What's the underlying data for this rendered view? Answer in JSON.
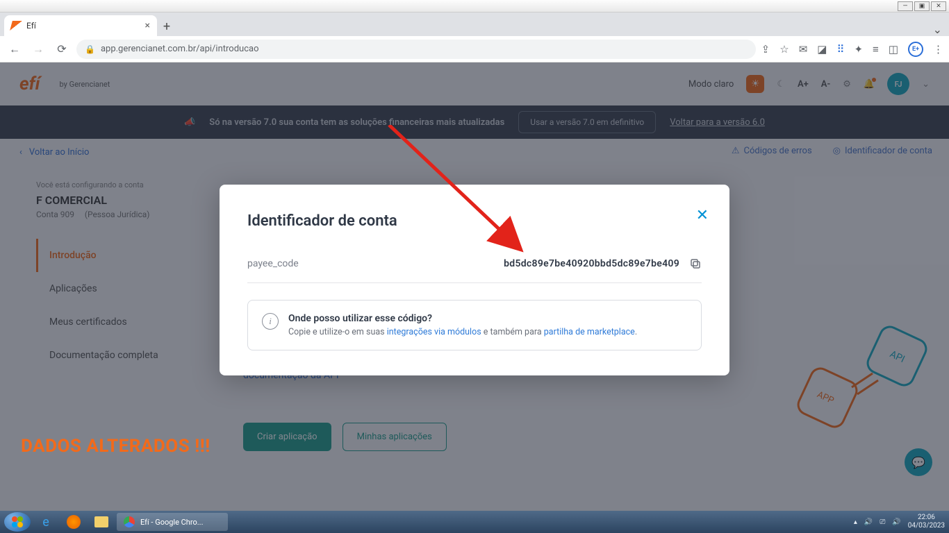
{
  "window": {
    "tab_title": "Efí",
    "url": "app.gerencianet.com.br/api/introducao"
  },
  "header": {
    "logo": "efí",
    "logo_sub": "by Gerencianet",
    "theme_label": "Modo claro",
    "font_inc": "A+",
    "font_dec": "A-",
    "avatar": "FJ"
  },
  "banner": {
    "text": "Só na versão 7.0 sua conta tem as soluções financeiras mais atualizadas",
    "btn": "Usar a versão 7.0 em definitivo",
    "link": "Voltar para a versão 6.0"
  },
  "breadcrumb": {
    "back": "Voltar ao Início"
  },
  "sidebar": {
    "sub": "Você está configurando a conta",
    "title": "F COMERCIAL",
    "meta_account": "Conta 909",
    "meta_type": "(Pessoa Jurídica)",
    "items": [
      {
        "label": "Introdução"
      },
      {
        "label": "Aplicações"
      },
      {
        "label": "Meus certificados"
      },
      {
        "label": "Documentação completa"
      }
    ]
  },
  "top_links": {
    "errors": "Códigos de erros",
    "ident": "Identificador de conta"
  },
  "main": {
    "doc_link": "documentação da API",
    "btn_create": "Criar aplicação",
    "btn_mine": "Minhas aplicações"
  },
  "modal": {
    "title": "Identificador de conta",
    "code_label": "payee_code",
    "code_value": "bd5dc89e7be40920bbd5dc89e7be409",
    "info_title": "Onde posso utilizar esse código?",
    "info_pre": "Copie e utilize-o em suas ",
    "info_link1": "integrações via módulos",
    "info_mid": " e também para ",
    "info_link2": "partilha de marketplace",
    "info_post": "."
  },
  "watermark": "DADOS ALTERADOS !!!",
  "taskbar": {
    "active": "Efí - Google Chro...",
    "time": "22:06",
    "date": "04/03/2023"
  }
}
